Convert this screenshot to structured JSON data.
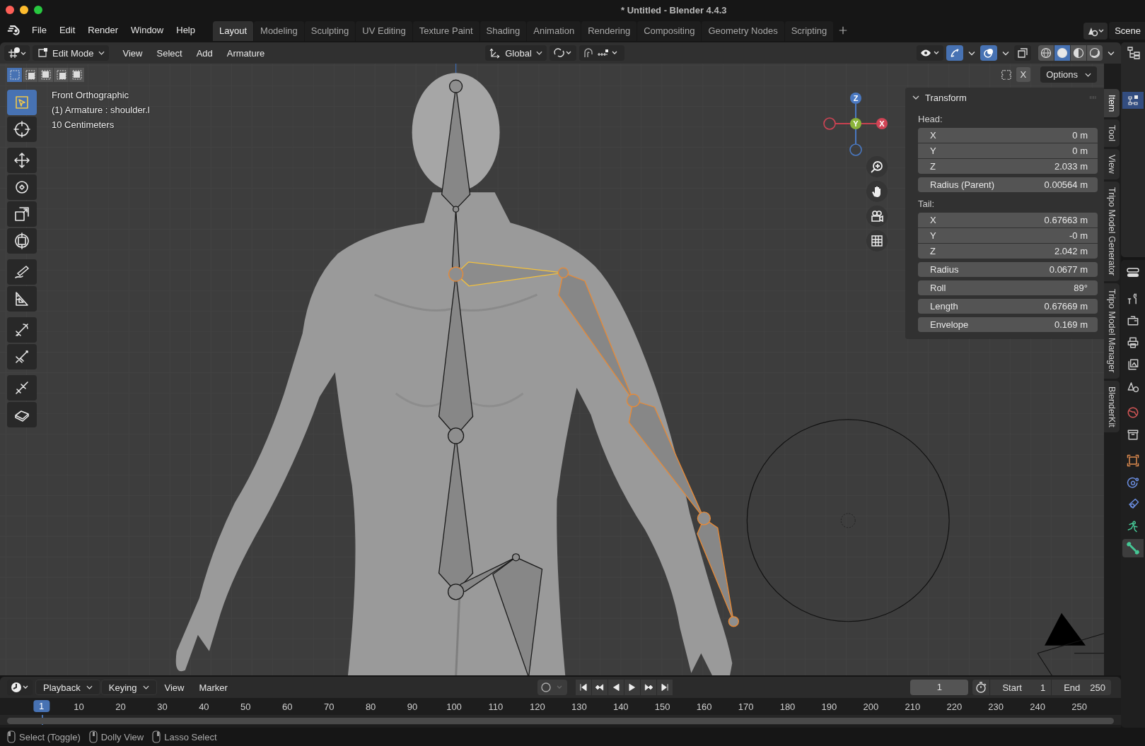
{
  "window": {
    "title": "* Untitled - Blender 4.4.3"
  },
  "menu": [
    "File",
    "Edit",
    "Render",
    "Window",
    "Help"
  ],
  "workspaces": [
    {
      "label": "Layout",
      "selected": true
    },
    {
      "label": "Modeling",
      "selected": false
    },
    {
      "label": "Sculpting",
      "selected": false
    },
    {
      "label": "UV Editing",
      "selected": false
    },
    {
      "label": "Texture Paint",
      "selected": false
    },
    {
      "label": "Shading",
      "selected": false
    },
    {
      "label": "Animation",
      "selected": false
    },
    {
      "label": "Rendering",
      "selected": false
    },
    {
      "label": "Compositing",
      "selected": false
    },
    {
      "label": "Geometry Nodes",
      "selected": false
    },
    {
      "label": "Scripting",
      "selected": false
    }
  ],
  "scene": "Scene",
  "viewport_header": {
    "mode": "Edit Mode",
    "menus": [
      "View",
      "Select",
      "Add",
      "Armature"
    ],
    "orientation": "Global",
    "gizmos_on": true,
    "overlays_on": true,
    "xray": false,
    "shading": [
      {
        "kind": "wireframe",
        "selected": false
      },
      {
        "kind": "solid",
        "selected": true
      },
      {
        "kind": "material",
        "selected": false
      },
      {
        "kind": "rendered",
        "selected": false
      }
    ]
  },
  "select_modes": [
    {
      "selected": true
    },
    {
      "selected": false
    },
    {
      "selected": false
    },
    {
      "selected": false
    },
    {
      "selected": false
    }
  ],
  "mirror_label": "X",
  "options_label": "Options",
  "tools": [
    {
      "kind": "select",
      "selected": true
    },
    {
      "kind": "cursor",
      "selected": false
    },
    {
      "kind": "move",
      "selected": false
    },
    {
      "kind": "rotate",
      "selected": false
    },
    {
      "kind": "scale",
      "selected": false
    },
    {
      "kind": "transform",
      "selected": false
    },
    {
      "kind": "annotate",
      "selected": false
    },
    {
      "kind": "measure",
      "selected": false
    },
    {
      "kind": "roll",
      "selected": false
    },
    {
      "kind": "bone_size",
      "selected": false
    },
    {
      "kind": "extrude",
      "selected": false
    },
    {
      "kind": "envelope",
      "selected": false
    }
  ],
  "overlay_info": [
    "Front Orthographic",
    "(1) Armature : shoulder.l",
    "10 Centimeters"
  ],
  "gizmo": {
    "x": "X",
    "y": "Y",
    "z": "Z"
  },
  "transform": {
    "title": "Transform",
    "head_label": "Head:",
    "head": [
      {
        "label": "X",
        "value": "0 m"
      },
      {
        "label": "Y",
        "value": "0 m"
      },
      {
        "label": "Z",
        "value": "2.033 m"
      }
    ],
    "head_radius": {
      "label": "Radius (Parent)",
      "value": "0.00564 m"
    },
    "tail_label": "Tail:",
    "tail": [
      {
        "label": "X",
        "value": "0.67663 m"
      },
      {
        "label": "Y",
        "value": "-0 m"
      },
      {
        "label": "Z",
        "value": "2.042 m"
      }
    ],
    "extra": [
      {
        "label": "Radius",
        "value": "0.0677 m"
      },
      {
        "label": "Roll",
        "value": "89°"
      },
      {
        "label": "Length",
        "value": "0.67669 m"
      },
      {
        "label": "Envelope",
        "value": "0.169 m"
      }
    ]
  },
  "sidebar_tabs": [
    {
      "label": "Item",
      "selected": true
    },
    {
      "label": "Tool",
      "selected": false
    },
    {
      "label": "View",
      "selected": false
    },
    {
      "label": "Tripo Model Generator",
      "selected": false
    },
    {
      "label": "Tripo Model Manager",
      "selected": false
    },
    {
      "label": "BlenderKit",
      "selected": false
    }
  ],
  "properties_tabs": [
    {
      "kind": "tool",
      "selected": false
    },
    {
      "kind": "render",
      "selected": false
    },
    {
      "kind": "output",
      "selected": false
    },
    {
      "kind": "view_layer",
      "selected": false
    },
    {
      "kind": "scene",
      "selected": false
    },
    {
      "kind": "world",
      "selected": false
    },
    {
      "kind": "collection",
      "selected": false
    },
    {
      "kind": "object",
      "selected": false
    },
    {
      "kind": "physics",
      "selected": false
    },
    {
      "kind": "constraints",
      "selected": false
    },
    {
      "kind": "data",
      "selected": false
    },
    {
      "kind": "bone",
      "selected": true
    }
  ],
  "timeline": {
    "menus": [
      {
        "label": "Playback",
        "kind": "dropdown"
      },
      {
        "label": "Keying",
        "kind": "dropdown"
      },
      {
        "label": "View",
        "kind": "menu"
      },
      {
        "label": "Marker",
        "kind": "menu"
      }
    ],
    "playhead_frame": "1",
    "auto_keying": false,
    "current_frame": "1",
    "start_label": "Start",
    "start": "1",
    "end_label": "End",
    "end": "250",
    "ruler": [
      "10",
      "20",
      "30",
      "40",
      "50",
      "60",
      "70",
      "80",
      "90",
      "100",
      "110",
      "120",
      "130",
      "140",
      "150",
      "160",
      "170",
      "180",
      "190",
      "200",
      "210",
      "220",
      "230",
      "240",
      "250"
    ]
  },
  "status_bar": [
    "Select (Toggle)",
    "Dolly View",
    "Lasso Select"
  ]
}
